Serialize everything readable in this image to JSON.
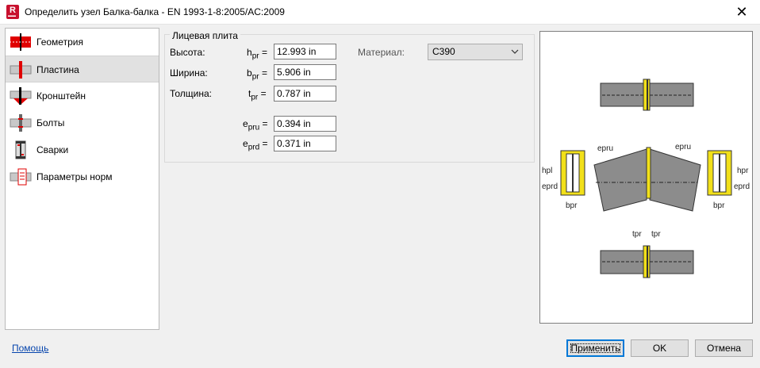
{
  "window": {
    "title": "Определить узел Балка-балка - EN 1993-1-8:2005/AC:2009",
    "app_icon_letter": "R",
    "close_glyph": "✕"
  },
  "sidebar": {
    "items": [
      {
        "label": "Геометрия",
        "icon": "geometry-icon"
      },
      {
        "label": "Пластина",
        "icon": "plate-icon",
        "selected": true
      },
      {
        "label": "Кронштейн",
        "icon": "bracket-icon"
      },
      {
        "label": "Болты",
        "icon": "bolts-icon"
      },
      {
        "label": "Сварки",
        "icon": "welds-icon"
      },
      {
        "label": "Параметры норм",
        "icon": "code-params-icon"
      }
    ]
  },
  "plate": {
    "group_title": "Лицевая плита",
    "height": {
      "label": "Высота:",
      "sym": "h",
      "sub": "pr",
      "value": "12.993 in"
    },
    "width": {
      "label": "Ширина:",
      "sym": "b",
      "sub": "pr",
      "value": "5.906 in"
    },
    "thickness": {
      "label": "Толщина:",
      "sym": "t",
      "sub": "pr",
      "value": "0.787 in"
    },
    "e_pru": {
      "sym": "e",
      "sub": "pru",
      "value": "0.394 in"
    },
    "e_prd": {
      "sym": "e",
      "sub": "prd",
      "value": "0.371 in"
    },
    "eq": "=",
    "material_label": "Материал:",
    "material_value": "C390"
  },
  "preview": {
    "labels": {
      "e_pru": "epru",
      "e_prd": "eprd",
      "h_pl": "hpl",
      "h_pr": "hpr",
      "b_pr": "bpr",
      "t_pr": "tpr"
    }
  },
  "footer": {
    "help": "Помощь",
    "apply": "Применить",
    "ok": "OK",
    "cancel": "Отмена"
  },
  "colors": {
    "accent": "#0078d7",
    "plate_yellow": "#f2e01a",
    "beam_gray": "#8c8c8c",
    "icon_red": "#e00000"
  }
}
